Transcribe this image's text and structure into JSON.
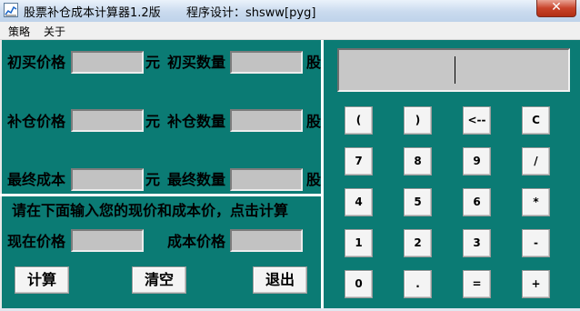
{
  "window": {
    "title": "股票补仓成本计算器1.2版",
    "subtitle": "程序设计：shsww[pyg]",
    "close_glyph": "✕"
  },
  "menu": {
    "items": [
      "策略",
      "关于"
    ]
  },
  "form": {
    "initial_price_label": "初买价格",
    "initial_qty_label": "初买数量",
    "add_price_label": "补仓价格",
    "add_qty_label": "补仓数量",
    "final_cost_label": "最终成本",
    "final_qty_label": "最终数量",
    "unit_yuan": "元",
    "unit_share": "股",
    "fields": {
      "initial_price": "",
      "initial_qty": "",
      "add_price": "",
      "add_qty": "",
      "final_cost": "",
      "final_qty": "",
      "current_price": "",
      "cost_price": ""
    },
    "instruction": "请在下面输入您的现价和成本价，点击计算",
    "current_price_label": "现在价格",
    "cost_price_label": "成本价格"
  },
  "actions": {
    "calculate": "计算",
    "clear": "清空",
    "exit": "退出"
  },
  "calculator": {
    "display_value": "",
    "keys": [
      [
        "(",
        ")",
        "<--",
        "C"
      ],
      [
        "7",
        "8",
        "9",
        "/"
      ],
      [
        "4",
        "5",
        "6",
        "*"
      ],
      [
        "1",
        "2",
        "3",
        "-"
      ],
      [
        "0",
        ".",
        "=",
        "+"
      ]
    ]
  },
  "colors": {
    "panel_bg": "#0b7b74",
    "field_bg": "#c2c2c2",
    "button_bg": "#f4f4f4"
  }
}
